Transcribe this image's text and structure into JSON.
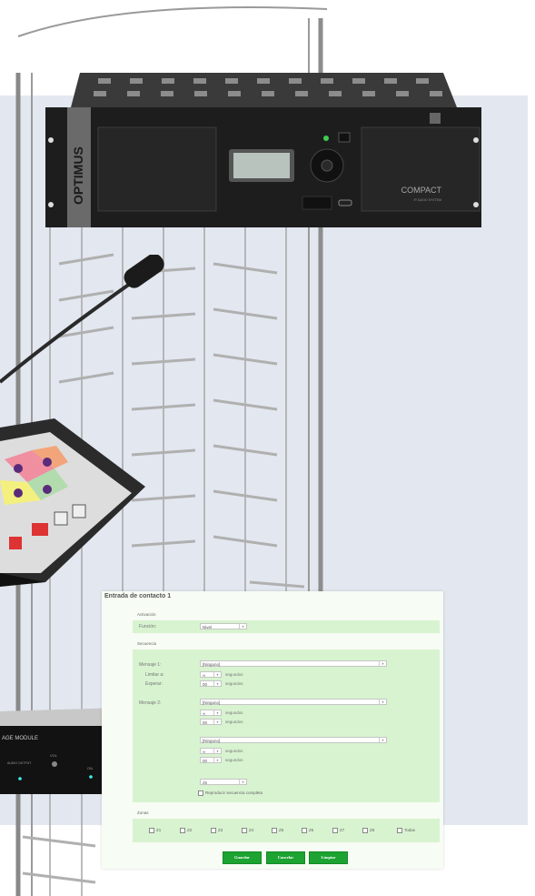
{
  "rack": {
    "brand": "OPTIMUS",
    "model": "COMPACT",
    "model_sub": "IP AUDIO SYSTEM"
  },
  "module": {
    "title": "AGE MODULE",
    "labels": {
      "audio": "AUDIO OUTPUT",
      "vol": "VOL",
      "on": "ON",
      "power": "POWER"
    }
  },
  "form": {
    "title": "Entrada de contacto 1",
    "activation": {
      "heading": "Activación",
      "function_label": "Función:",
      "function_value": "Nivel"
    },
    "sequence": {
      "heading": "Secuencia",
      "messages": [
        {
          "label": "Mensaje 1:",
          "value": "[Ninguno]",
          "limit_label": "Limitar a:",
          "limit_value": "∞",
          "wait_label": "Esperar:",
          "wait_value": "00",
          "unit": "segundos"
        },
        {
          "label": "Mensaje 2:",
          "value": "[Ninguno]",
          "limit_value": "∞",
          "wait_value": "00",
          "unit": "segundos"
        },
        {
          "label": "",
          "value": "[Ninguno]",
          "limit_value": "∞",
          "wait_value": "00",
          "unit": "segundos"
        }
      ],
      "repeat_value": "25",
      "checkbox_label": "Reproducir secuencia completa"
    },
    "zones": {
      "heading": "Zonas",
      "items": [
        "Z1",
        "Z2",
        "Z3",
        "Z4",
        "Z5",
        "Z6",
        "Z7",
        "Z8",
        "Todas"
      ]
    },
    "buttons": {
      "save": "Guardar",
      "cancel": "Cancelar",
      "clear": "Limpiar"
    }
  }
}
